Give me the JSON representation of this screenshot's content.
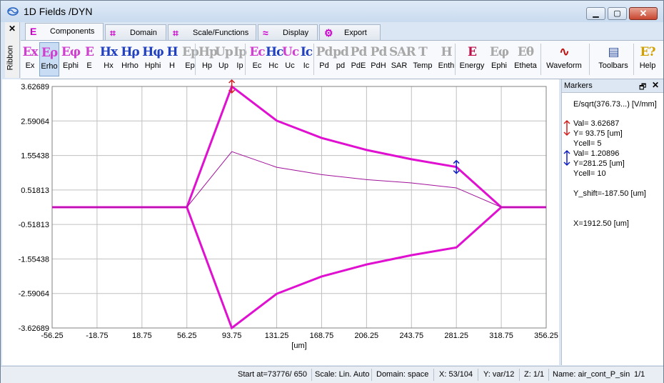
{
  "window": {
    "title": "1D Fields /DYN",
    "min": "▁",
    "max": "▢",
    "close": "✕"
  },
  "sidebar": {
    "close": "✕",
    "label": "Ribbon"
  },
  "tabs": [
    {
      "label": "Components",
      "icon": "E",
      "active": true
    },
    {
      "label": "Domain",
      "icon": "⌗"
    },
    {
      "label": "Scale/Functions",
      "icon": "⌗"
    },
    {
      "label": "Display",
      "icon": "≈"
    },
    {
      "label": "Export",
      "icon": "⚙"
    }
  ],
  "ribbon": [
    {
      "glyph": "Ex",
      "label": "Ex",
      "color": "#d040d0"
    },
    {
      "glyph": "Eρ",
      "label": "Erho",
      "color": "#d040d0",
      "active": true
    },
    {
      "glyph": "Eφ",
      "label": "Ephi",
      "color": "#d040d0"
    },
    {
      "glyph": "E",
      "label": "E",
      "color": "#d040d0"
    },
    {
      "glyph": "Hx",
      "label": "Hx",
      "color": "#2040c0"
    },
    {
      "glyph": "Hρ",
      "label": "Hrho",
      "color": "#2040c0"
    },
    {
      "glyph": "Hφ",
      "label": "Hphi",
      "color": "#2040c0"
    },
    {
      "glyph": "H",
      "label": "H",
      "color": "#2040c0"
    },
    {
      "glyph": "Ep",
      "label": "Ep",
      "color": "#a8a8a8"
    },
    {
      "glyph": "Hp",
      "label": "Hp",
      "color": "#a8a8a8"
    },
    {
      "glyph": "Up",
      "label": "Up",
      "color": "#a8a8a8"
    },
    {
      "glyph": "Ip",
      "label": "Ip",
      "color": "#a8a8a8"
    },
    {
      "glyph": "Ec",
      "label": "Ec",
      "color": "#d040d0"
    },
    {
      "glyph": "Hc",
      "label": "Hc",
      "color": "#2040c0"
    },
    {
      "glyph": "Uc",
      "label": "Uc",
      "color": "#d040d0"
    },
    {
      "glyph": "Ic",
      "label": "Ic",
      "color": "#2040c0"
    },
    {
      "glyph": "Pd",
      "label": "Pd",
      "color": "#a8a8a8"
    },
    {
      "glyph": "pd",
      "label": "pd",
      "color": "#a8a8a8"
    },
    {
      "glyph": "Pd",
      "label": "PdE",
      "color": "#a8a8a8"
    },
    {
      "glyph": "Pd",
      "label": "PdH",
      "color": "#a8a8a8"
    },
    {
      "glyph": "SAR",
      "label": "SAR",
      "color": "#a8a8a8"
    },
    {
      "glyph": "T",
      "label": "Temp",
      "color": "#a8a8a8"
    },
    {
      "glyph": "H",
      "label": "Enth",
      "color": "#a8a8a8"
    },
    {
      "glyph": "E",
      "label": "Energy",
      "color": "#c0104a"
    },
    {
      "glyph": "Eφ",
      "label": "Ephi",
      "color": "#a8a8a8"
    },
    {
      "glyph": "Eθ",
      "label": "Etheta",
      "color": "#a8a8a8"
    },
    {
      "glyph": "∿",
      "label": "Waveform",
      "color": "#c01010"
    },
    {
      "glyph": "▤",
      "label": "Toolbars",
      "color": "#3050a0"
    },
    {
      "glyph": "E?",
      "label": "Help",
      "color": "#d0a000"
    }
  ],
  "chart_data": {
    "type": "line",
    "xlabel": "[um]",
    "ylabel": "",
    "xlim": [
      -56.25,
      356.25
    ],
    "ylim": [
      -3.62689,
      3.62689
    ],
    "x_ticks": [
      "-56.25",
      "-18.75",
      "18.75",
      "56.25",
      "93.75",
      "131.25",
      "168.75",
      "206.25",
      "243.75",
      "281.25",
      "318.75",
      "356.25"
    ],
    "y_ticks": [
      "3.62689",
      "2.59064",
      "1.55438",
      "0.51813",
      "-0.51813",
      "-1.55438",
      "-2.59064",
      "-3.62689"
    ],
    "grid": true,
    "series": [
      {
        "color": "#e010d0",
        "width": 3,
        "x": [
          -56.25,
          56.25,
          93.75,
          131.25,
          168.75,
          206.25,
          243.75,
          281.25,
          318.75,
          356.25
        ],
        "y": [
          0,
          0,
          3.62687,
          2.6,
          2.08,
          1.72,
          1.44,
          1.20896,
          0,
          0
        ]
      },
      {
        "color": "#e010d0",
        "width": 3,
        "x": [
          -56.25,
          56.25,
          93.75,
          131.25,
          168.75,
          206.25,
          243.75,
          281.25,
          318.75,
          356.25
        ],
        "y": [
          0,
          0,
          -3.62687,
          -2.6,
          -2.08,
          -1.72,
          -1.44,
          -1.20896,
          0,
          0
        ]
      },
      {
        "color": "#a0109a",
        "width": 1,
        "x": [
          -56.25,
          56.25,
          93.75,
          131.25,
          168.75,
          206.25,
          243.75,
          281.25,
          318.75,
          356.25
        ],
        "y": [
          0,
          0,
          1.67,
          1.2,
          0.98,
          0.83,
          0.73,
          0.58,
          0,
          0
        ]
      }
    ],
    "markers": [
      {
        "x": 93.75,
        "y": 3.62687,
        "color": "#d02020"
      },
      {
        "x": 281.25,
        "y": 1.20896,
        "color": "#1020c0"
      }
    ]
  },
  "markers_panel": {
    "title": "Markers",
    "pin": "🗗",
    "close": "✕",
    "quantity": "E/sqrt(376.73...) [V/mm]",
    "marker1": {
      "val": "Val=  3.62687",
      "y": "Y= 93.75 [um]",
      "ycell": "Ycell= 5",
      "color": "#d02020"
    },
    "marker2": {
      "val": "Val=  1.20896",
      "y": "Y=281.25 [um]",
      "ycell": "Ycell= 10",
      "color": "#1020c0"
    },
    "yshift": "Y_shift=-187.50 [um]",
    "x": "X=1912.50 [um]"
  },
  "status": {
    "start": "Start at=73776/ 650",
    "scale": "Scale: Lin. Auto",
    "domain": "Domain: space",
    "x": "X: 53/104",
    "y": "Y: var/12",
    "z": "Z: 1/1",
    "name": "Name:  air_cont_P_sin",
    "page": "1/1"
  }
}
